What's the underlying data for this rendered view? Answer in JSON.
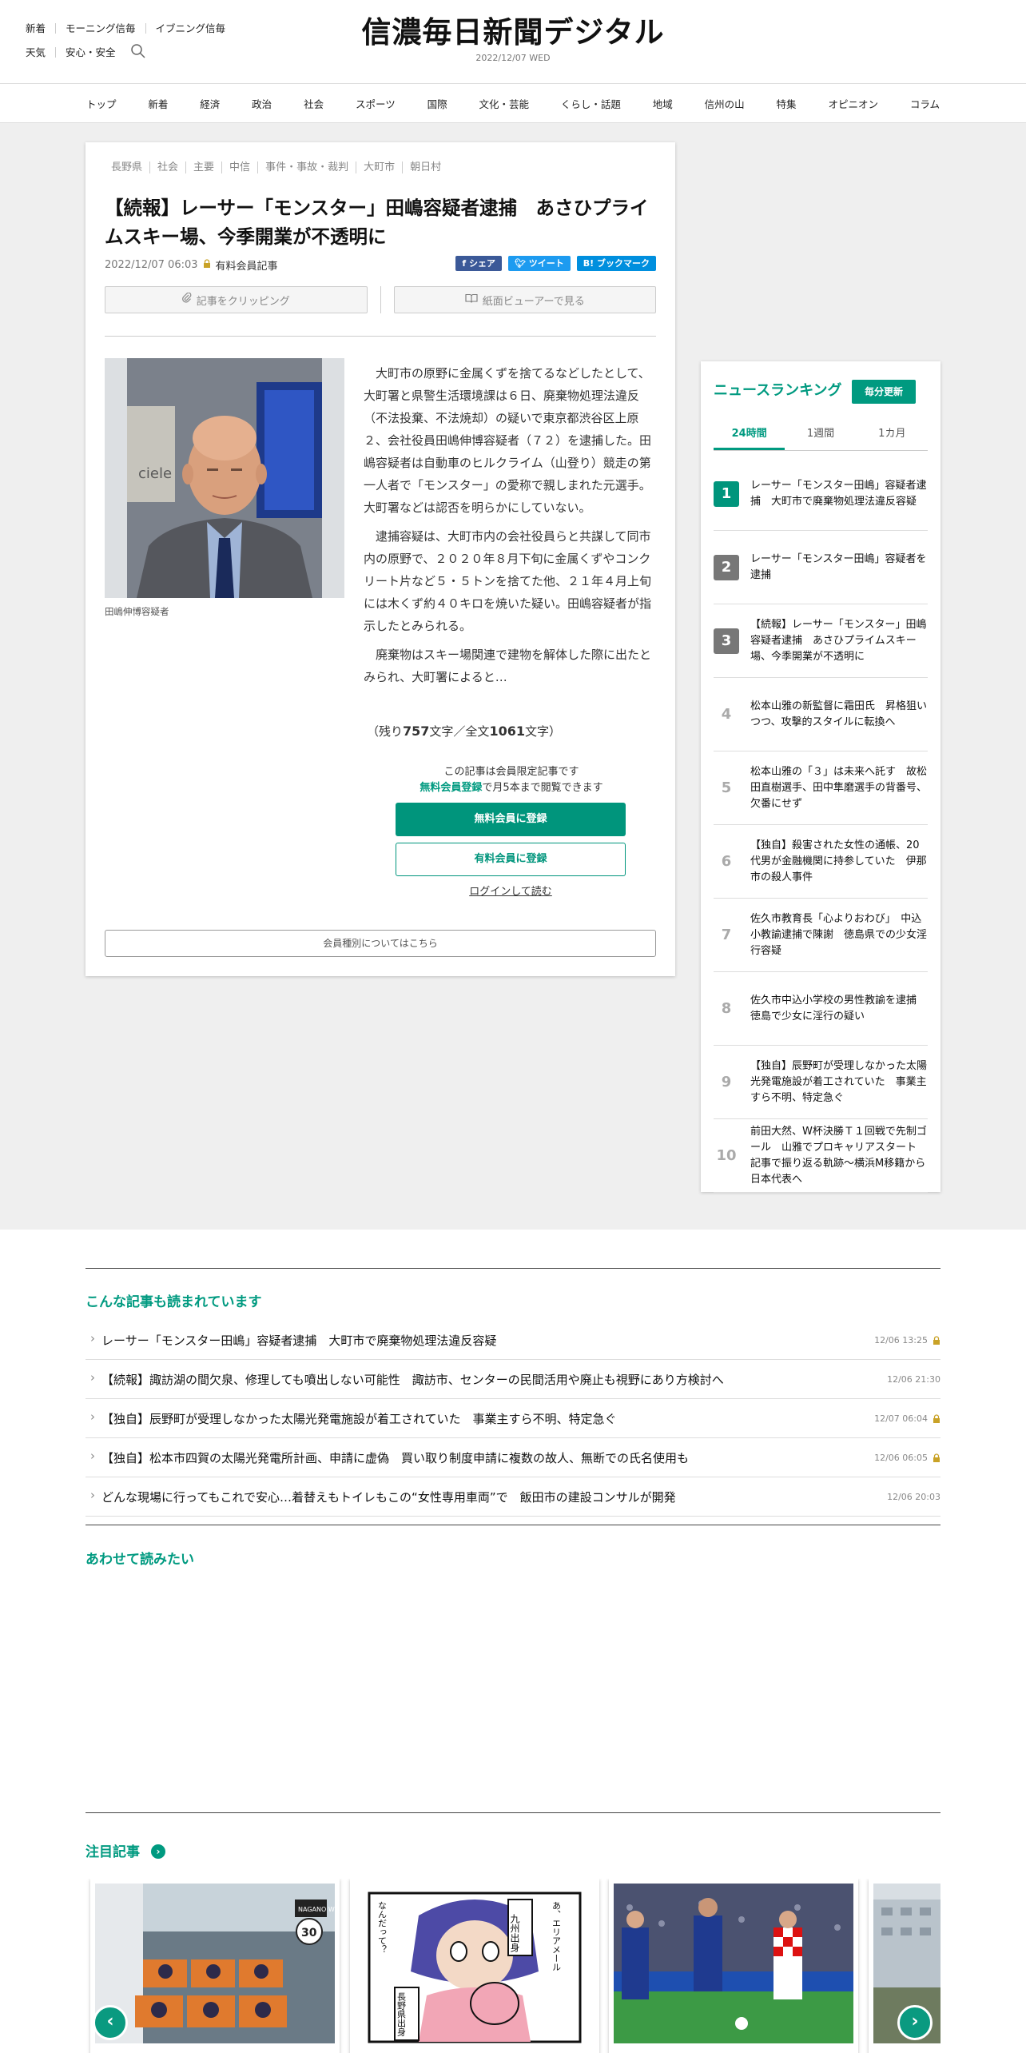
{
  "header": {
    "links_row1": [
      "新着",
      "モーニング信毎",
      "イブニング信毎"
    ],
    "links_row2": [
      "天気",
      "安心・安全"
    ],
    "logo": "信濃毎日新聞デジタル",
    "date": "2022/12/07 WED"
  },
  "nav": [
    "トップ",
    "新着",
    "経済",
    "政治",
    "社会",
    "スポーツ",
    "国際",
    "文化・芸能",
    "くらし・話題",
    "地域",
    "信州の山",
    "特集",
    "オピニオン",
    "コラム"
  ],
  "article": {
    "tags": [
      "長野県",
      "社会",
      "主要",
      "中信",
      "事件・事故・裁判",
      "大町市",
      "朝日村"
    ],
    "title": "【続報】レーサー「モンスター」田嶋容疑者逮捕　あさひプライムスキー場、今季開業が不透明に",
    "datetime": "2022/12/07 06:03",
    "paid_label": "有料会員記事",
    "share": {
      "facebook": "シェア",
      "twitter": "ツイート",
      "hatena": "ブックマーク"
    },
    "clip_button": "記事をクリッピング",
    "viewer_button": "紙面ビューアーで見る",
    "photo_caption": "田嶋伸博容疑者",
    "paragraphs": [
      "大町市の原野に金属くずを捨てるなどしたとして、大町署と県警生活環境課は６日、廃棄物処理法違反（不法投棄、不法焼却）の疑いで東京都渋谷区上原２、会社役員田嶋伸博容疑者（７２）を逮捕した。田嶋容疑者は自動車のヒルクライム（山登り）競走の第一人者で「モンスター」の愛称で親しまれた元選手。大町署などは認否を明らかにしていない。",
      "逮捕容疑は、大町市内の会社役員らと共謀して同市内の原野で、２０２０年８月下旬に金属くずやコンクリート片など５・５トンを捨てた他、２１年４月上旬には木くず約４０キロを焼いた疑い。田嶋容疑者が指示したとみられる。",
      "廃棄物はスキー場関連で建物を解体した際に出たとみられ、大町署によると…"
    ],
    "remaining": {
      "prefix": "（残り",
      "remain": "757",
      "mid": "文字／全文",
      "total": "1061",
      "suffix": "文字）"
    },
    "gate": {
      "line1": "この記事は会員限定記事です",
      "line2_link": "無料会員登録",
      "line2_rest": "で月5本まで閲覧できます",
      "free_button": "無料会員に登録",
      "paid_button": "有料会員に登録",
      "login": "ログインして読む"
    },
    "member_types": "会員種別についてはこちら"
  },
  "ranking": {
    "heading": "ニュースランキング",
    "update_badge": "毎分更新",
    "tabs": [
      "24時間",
      "1週間",
      "1カ月"
    ],
    "active_tab": "24時間",
    "items": [
      {
        "rank": "1",
        "title": "レーサー「モンスター田嶋」容疑者逮捕　大町市で廃棄物処理法違反容疑"
      },
      {
        "rank": "2",
        "title": "レーサー「モンスター田嶋」容疑者を逮捕"
      },
      {
        "rank": "3",
        "title": "【続報】レーサー「モンスター」田嶋容疑者逮捕　あさひプライムスキー場、今季開業が不透明に"
      },
      {
        "rank": "4",
        "title": "松本山雅の新監督に霜田氏　昇格狙いつつ、攻撃的スタイルに転換へ"
      },
      {
        "rank": "5",
        "title": "松本山雅の「３」は未来へ託す　故松田直樹選手、田中隼磨選手の背番号、欠番にせず"
      },
      {
        "rank": "6",
        "title": "【独自】殺害された女性の通帳、20代男が金融機関に持参していた　伊那市の殺人事件"
      },
      {
        "rank": "7",
        "title": "佐久市教育長「心よりおわび」　中込小教諭逮捕で陳謝　徳島県での少女淫行容疑"
      },
      {
        "rank": "8",
        "title": "佐久市中込小学校の男性教諭を逮捕　徳島で少女に淫行の疑い"
      },
      {
        "rank": "9",
        "title": "【独自】辰野町が受理しなかった太陽光発電施設が着工されていた　事業主すら不明、特定急ぐ"
      },
      {
        "rank": "10",
        "title": "前田大然、W杯決勝Ｔ１回戦で先制ゴール　山雅でプロキャリアスタート　記事で振り返る軌跡～横浜M移籍から日本代表へ"
      }
    ],
    "accent": "#009a80",
    "top_badge_colors": [
      "#00957c",
      "#777777",
      "#777777"
    ]
  },
  "also_read": {
    "heading": "こんな記事も読まれています",
    "items": [
      {
        "title": "レーサー「モンスター田嶋」容疑者逮捕　大町市で廃棄物処理法違反容疑",
        "date": "12/06 13:25",
        "locked": true
      },
      {
        "title": "【続報】諏訪湖の間欠泉、修理しても噴出しない可能性　諏訪市、センターの民間活用や廃止も視野にあり方検討へ",
        "date": "12/06 21:30",
        "locked": false
      },
      {
        "title": "【独自】辰野町が受理しなかった太陽光発電施設が着工されていた　事業主すら不明、特定急ぐ",
        "date": "12/07 06:04",
        "locked": true
      },
      {
        "title": "【独自】松本市四賀の太陽光発電所計画、申請に虚偽　買い取り制度申請に複数の故人、無断での氏名使用も",
        "date": "12/06 06:05",
        "locked": true
      },
      {
        "title": "どんな現場に行ってもこれで安心…着替えもトイレもこの“女性専用車両”で　飯田市の建設コンサルが開発",
        "date": "12/06 20:03",
        "locked": false
      }
    ]
  },
  "read_together": {
    "heading": "あわせて読みたい"
  },
  "featured": {
    "heading": "注目記事",
    "go_icon": "›",
    "prev": "‹",
    "next": "›",
    "slide1_badge": "NAGANO WINE",
    "slide1_number": "30",
    "slide2_speech": [
      "九州出身",
      "長野県出身",
      "あ、エリアメール",
      "なんだって？"
    ]
  },
  "icons": [
    "search-icon",
    "lock-icon",
    "clip-icon",
    "book-icon",
    "facebook-icon",
    "twitter-icon",
    "hatena-icon",
    "chevron-left-icon",
    "chevron-right-icon"
  ]
}
